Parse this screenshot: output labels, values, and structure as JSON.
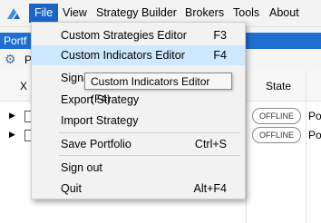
{
  "menubar": {
    "items": [
      {
        "label": "File"
      },
      {
        "label": "View"
      },
      {
        "label": "Strategy Builder"
      },
      {
        "label": "Brokers"
      },
      {
        "label": "Tools"
      },
      {
        "label": "About"
      }
    ]
  },
  "band": {
    "text": "Portf"
  },
  "toolbar": {
    "text": "P"
  },
  "grid": {
    "columns": [
      "X",
      "State"
    ],
    "rows": [
      {
        "state": "OFFLINE",
        "portfolio": "Po"
      },
      {
        "state": "OFFLINE",
        "portfolio": "Po"
      }
    ]
  },
  "file_menu": {
    "items": [
      {
        "label": "Custom Strategies Editor",
        "shortcut": "F3"
      },
      {
        "label": "Custom Indicators Editor",
        "shortcut": "F4"
      },
      {
        "label": "Signa",
        "shortcut": ""
      },
      {
        "label": "Export Strategy",
        "shortcut": ""
      },
      {
        "label": "Import Strategy",
        "shortcut": ""
      },
      {
        "label": "Save Portfolio",
        "shortcut": "Ctrl+S"
      },
      {
        "label": "Sign out",
        "shortcut": ""
      },
      {
        "label": "Quit",
        "shortcut": "Alt+F4"
      }
    ],
    "tooltip": "Custom Indicators Editor (F4)"
  }
}
